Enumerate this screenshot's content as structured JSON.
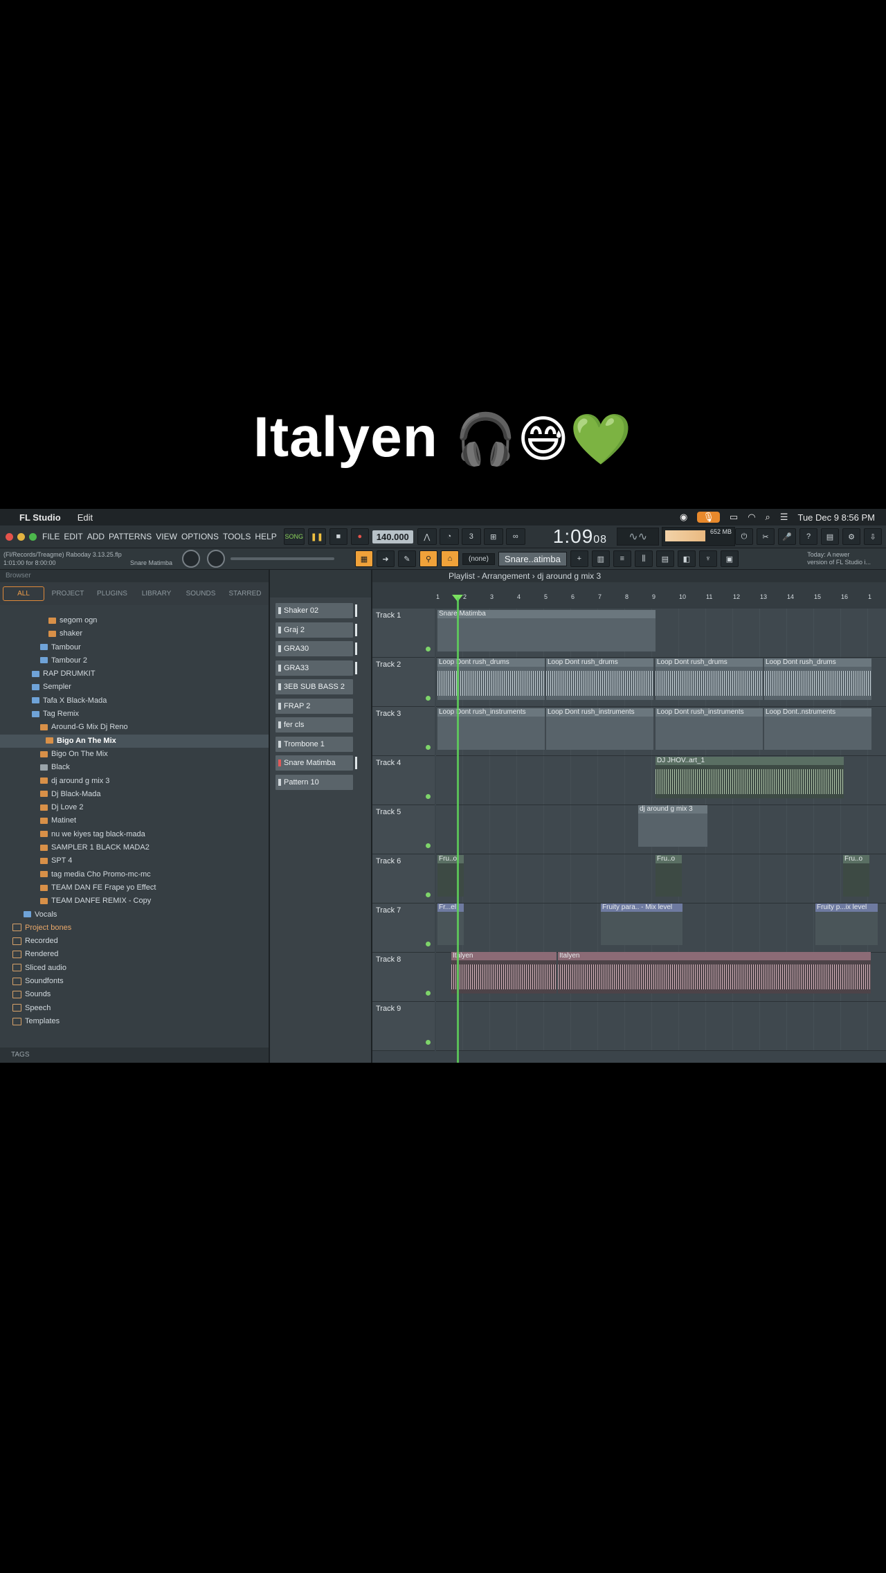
{
  "caption": {
    "text": "Italyen",
    "emoji": "🎧😅💚"
  },
  "macbar": {
    "app_name": "FL Studio",
    "menu_edit": "Edit",
    "datetime": "Tue Dec 9  8:56 PM"
  },
  "fl_menu": [
    "FILE",
    "EDIT",
    "ADD",
    "PATTERNS",
    "VIEW",
    "OPTIONS",
    "TOOLS",
    "HELP"
  ],
  "transport": {
    "song_label": "SONG",
    "tempo": "140.000",
    "time": "1:09",
    "time_small": "08",
    "mem": "652 MB"
  },
  "hint": {
    "line1": "(Fl/Records/Treagme) Raboday 3.13.25.flp",
    "line2": "1:01:00 for 8:00:00",
    "line2_right": "Snare Matimba"
  },
  "row2": {
    "pattern_select": "(none)",
    "channel_select": "Snare..atimba",
    "news_line1": "Today: A newer",
    "news_line2": "version of FL Studio i..."
  },
  "browser": {
    "header": "Browser",
    "tabs": [
      "ALL",
      "PROJECT",
      "PLUGINS",
      "LIBRARY",
      "SOUNDS",
      "STARRED"
    ],
    "items": [
      {
        "label": "segom ogn",
        "type": "wav",
        "indent": 70
      },
      {
        "label": "shaker",
        "type": "wav",
        "indent": 70
      },
      {
        "label": "Tambour",
        "type": "folder",
        "indent": 58
      },
      {
        "label": "Tambour 2",
        "type": "folder",
        "indent": 58
      },
      {
        "label": "RAP DRUMKIT",
        "type": "folder",
        "indent": 46
      },
      {
        "label": "Sempler",
        "type": "folder",
        "indent": 46
      },
      {
        "label": "Tafa X Black-Mada",
        "type": "folder",
        "indent": 46
      },
      {
        "label": "Tag Remix",
        "type": "folder",
        "indent": 46
      },
      {
        "label": "Around-G Mix Dj Reno",
        "type": "wav",
        "indent": 58
      },
      {
        "label": "Bigo An The Mix",
        "type": "wav",
        "indent": 66,
        "selected": true
      },
      {
        "label": "Bigo On The Mix",
        "type": "wav",
        "indent": 58
      },
      {
        "label": "Black",
        "type": "blank",
        "indent": 58
      },
      {
        "label": "dj around g mix 3",
        "type": "wav",
        "indent": 58
      },
      {
        "label": "Dj Black-Mada",
        "type": "wav",
        "indent": 58
      },
      {
        "label": "Dj Love 2",
        "type": "wav",
        "indent": 58
      },
      {
        "label": "Matinet",
        "type": "wav",
        "indent": 58
      },
      {
        "label": "nu we kiyes tag black-mada",
        "type": "wav",
        "indent": 58
      },
      {
        "label": "SAMPLER 1 BLACK MADA2",
        "type": "wav",
        "indent": 58
      },
      {
        "label": "SPT 4",
        "type": "wav",
        "indent": 58
      },
      {
        "label": "tag media Cho Promo-mc-mc",
        "type": "wav",
        "indent": 58
      },
      {
        "label": "TEAM DAN FE Frape yo Effect",
        "type": "wav",
        "indent": 58
      },
      {
        "label": "TEAM DANFE REMIX - Copy",
        "type": "wav",
        "indent": 58
      },
      {
        "label": "Vocals",
        "type": "folder",
        "indent": 34
      },
      {
        "label": "Project bones",
        "type": "pf",
        "indent": 18,
        "section": true
      },
      {
        "label": "Recorded",
        "type": "pf",
        "indent": 18
      },
      {
        "label": "Rendered",
        "type": "pf",
        "indent": 18
      },
      {
        "label": "Sliced audio",
        "type": "pf",
        "indent": 18
      },
      {
        "label": "Soundfonts",
        "type": "pf",
        "indent": 18
      },
      {
        "label": "Sounds",
        "type": "pf",
        "indent": 18
      },
      {
        "label": "Speech",
        "type": "pf",
        "indent": 18
      },
      {
        "label": "Templates",
        "type": "pf",
        "indent": 18
      }
    ],
    "tags_label": "TAGS"
  },
  "channels": [
    {
      "label": "Shaker 02"
    },
    {
      "label": "Graj 2"
    },
    {
      "label": "GRA30"
    },
    {
      "label": "GRA33"
    },
    {
      "label": "3EB SUB BASS 2 [clipped]"
    },
    {
      "label": "FRAP 2"
    },
    {
      "label": "fer cls"
    },
    {
      "label": "Trombone 1"
    },
    {
      "label": "Snare Matimba",
      "red": true
    },
    {
      "label": "Pattern 10"
    }
  ],
  "playlist": {
    "title": "Playlist - Arrangement",
    "crumb": "dj around g mix 3",
    "ruler": [
      "1",
      "2",
      "3",
      "4",
      "5",
      "6",
      "7",
      "8",
      "9",
      "10",
      "11",
      "12",
      "13",
      "14",
      "15",
      "16",
      "1"
    ],
    "tracks": [
      {
        "name": "Track 1"
      },
      {
        "name": "Track 2"
      },
      {
        "name": "Track 3"
      },
      {
        "name": "Track 4"
      },
      {
        "name": "Track 5"
      },
      {
        "name": "Track 6"
      },
      {
        "name": "Track 7"
      },
      {
        "name": "Track 8"
      },
      {
        "name": "Track 9"
      }
    ],
    "clips": {
      "t1": "Snare Matimba",
      "t2a": "Loop Dont rush_drums",
      "t2b": "Loop Dont rush_drums",
      "t2c": "Loop Dont rush_drums",
      "t2d": "Loop Dont rush_drums",
      "t3a": "Loop Dont rush_instruments",
      "t3b": "Loop Dont rush_instruments",
      "t3c": "Loop Dont rush_instruments",
      "t3d": "Loop Dont..nstruments",
      "t4": "DJ JHOV..art_1",
      "t5": "dj around g mix 3",
      "t6a": "Fru..o",
      "t6b": "Fru..o",
      "t6c": "Fru..o",
      "t7a": "Fr...el",
      "t7b": "Fruity para.. - Mix level",
      "t7c": "Fruity p...ix level",
      "t8a": "Italyen",
      "t8b": "Italyen"
    }
  }
}
